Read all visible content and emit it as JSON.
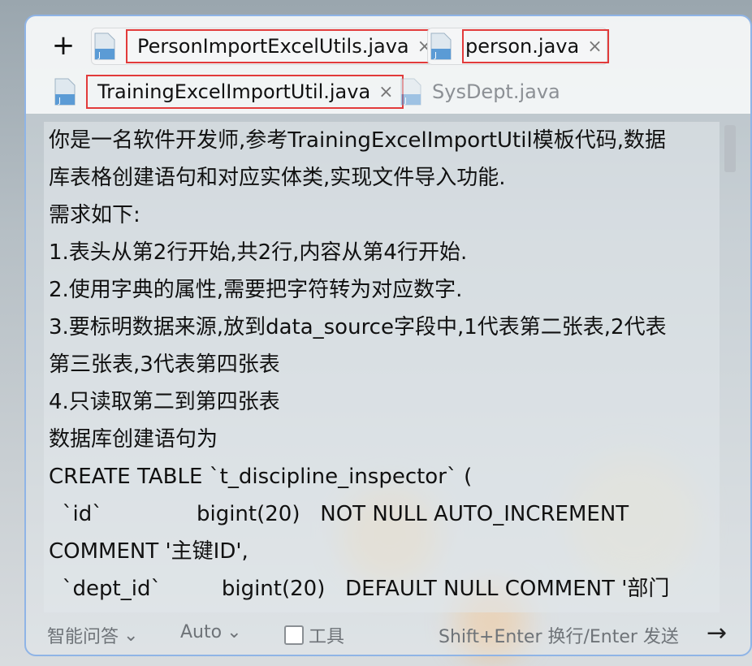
{
  "tabs": [
    {
      "label": "PersonImportExcelUtils.java",
      "close": "×",
      "icon": "java-file-icon"
    },
    {
      "label": "person.java",
      "close": "×",
      "icon": "java-file-icon"
    },
    {
      "label": "TrainingExcelImportUtil.java",
      "close": "×",
      "icon": "java-file-icon"
    },
    {
      "label": "SysDept.java",
      "icon": "java-file-icon"
    }
  ],
  "add_label": "+",
  "content_lines": [
    "你是一名软件开发师,参考TrainingExcelImportUtil模板代码,数据",
    "库表格创建语句和对应实体类,实现文件导入功能.",
    "需求如下:",
    "1.表头从第2行开始,共2行,内容从第4行开始.",
    "2.使用字典的属性,需要把字符转为对应数字.",
    "3.要标明数据来源,放到data_source字段中,1代表第二张表,2代表",
    "第三张表,3代表第四张表",
    "4.只读取第二到第四张表",
    "数据库创建语句为",
    "CREATE TABLE `t_discipline_inspector` (",
    "  `id`              bigint(20)   NOT NULL AUTO_INCREMENT",
    "COMMENT '主键ID',",
    "  `dept_id`         bigint(20)   DEFAULT NULL COMMENT '部门"
  ],
  "footer": {
    "smart_qa": "智能问答",
    "auto": "Auto",
    "tools": "工具",
    "hint": "Shift+Enter 换行/Enter 发送",
    "send_arrow": "→"
  },
  "colors": {
    "highlight_border": "#e23b3b",
    "panel_border": "#8fb4e6"
  }
}
